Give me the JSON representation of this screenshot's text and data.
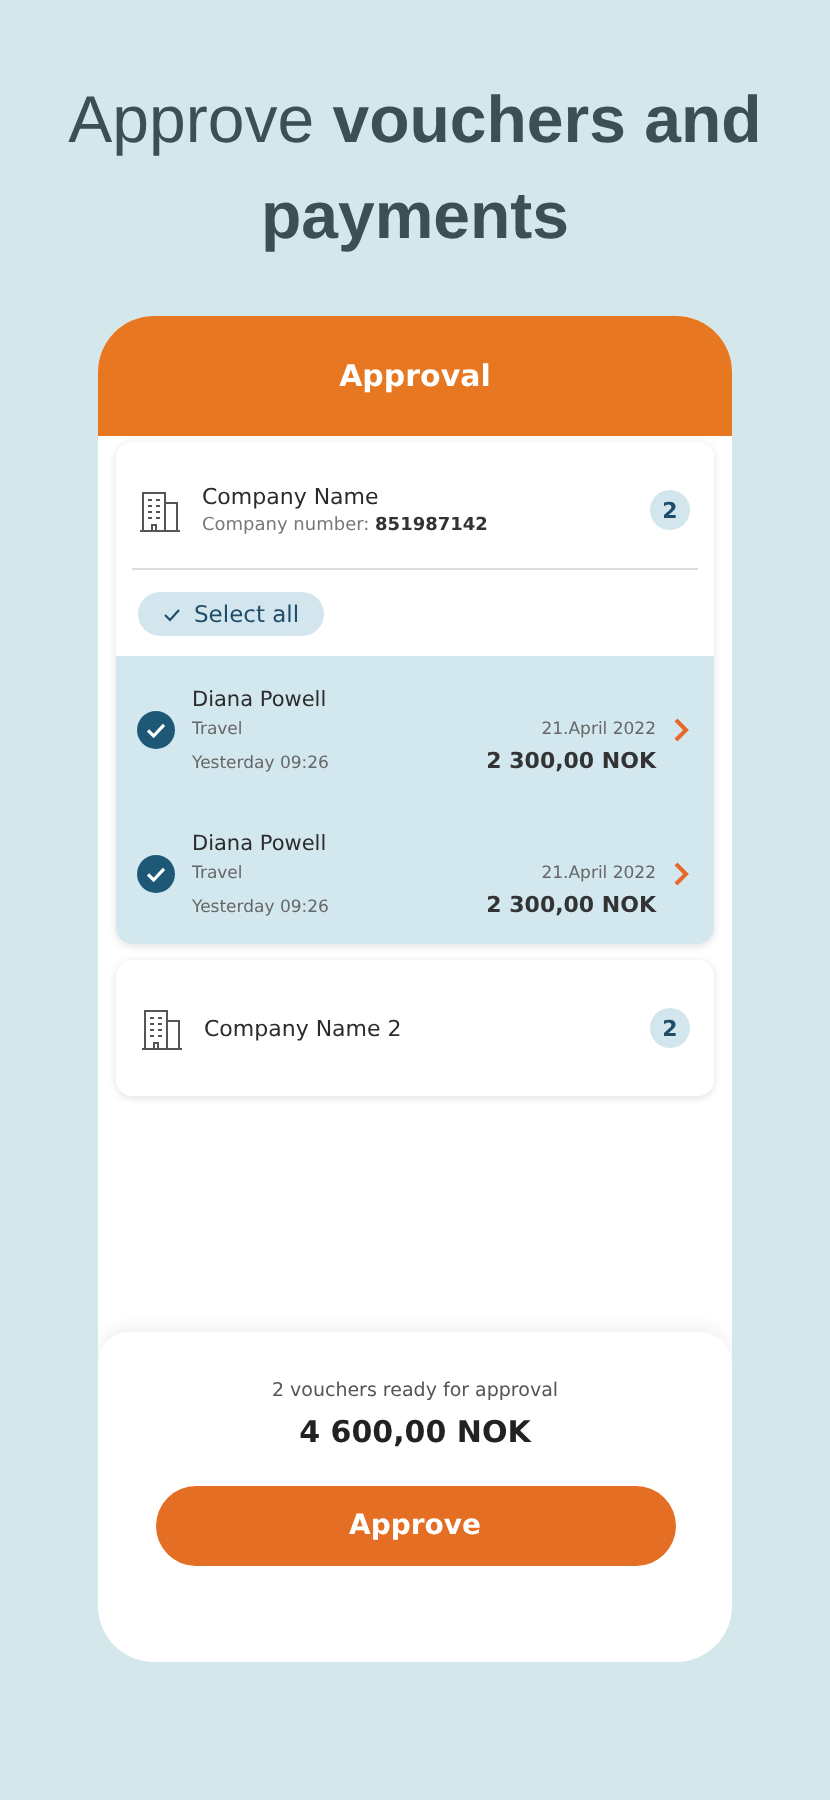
{
  "headline": "Approve **vouchers and payments**",
  "header": {
    "title": "Approval"
  },
  "companies": [
    {
      "name": "Company Name",
      "subtitle": "Company number: **851987142**",
      "count": "2",
      "expanded": true,
      "select_all": {
        "label": "Select all",
        "checked": true
      },
      "vouchers": [
        {
          "name": "Diana Powell",
          "category": "Travel",
          "time": "Yesterday 09:26",
          "date": "21.April 2022",
          "amount": "2 300,00 NOK",
          "selected": true
        },
        {
          "name": "Diana Powell",
          "category": "Travel",
          "time": "Yesterday 09:26",
          "date": "21.April 2022",
          "amount": "2 300,00 NOK",
          "selected": true
        }
      ]
    },
    {
      "name": "Company Name 2",
      "count": "2",
      "expanded": false
    }
  ],
  "footer": {
    "summary": "2 vouchers ready for approval",
    "total": "4 600,00 NOK",
    "button": "Approve"
  }
}
